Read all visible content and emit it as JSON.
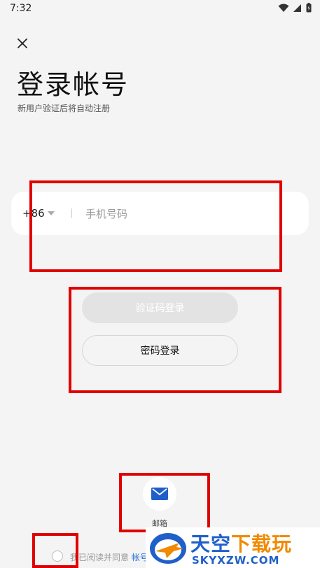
{
  "status_bar": {
    "time": "7:32",
    "icons": [
      "wifi-icon",
      "signal-icon",
      "battery-icon"
    ]
  },
  "header": {
    "close_icon": "close-icon",
    "title": "登录帐号",
    "subtitle": "新用户验证后将自动注册"
  },
  "phone": {
    "country_code": "+86",
    "placeholder": "手机号码"
  },
  "buttons": {
    "sms_login": "验证码登录",
    "password_login": "密码登录"
  },
  "email": {
    "icon": "mail-icon",
    "label": "邮箱"
  },
  "agreement": {
    "text": "我已阅读并同意",
    "link": "帐号"
  },
  "watermark": {
    "main_blue": "天空",
    "main_orange": "下载玩",
    "sub": "SKYXZW.COM"
  },
  "colors": {
    "accent_blue": "#2a6fd6",
    "annotation_red": "#e00000",
    "watermark_blue": "#1f5fc9",
    "watermark_orange": "#f08a00"
  }
}
